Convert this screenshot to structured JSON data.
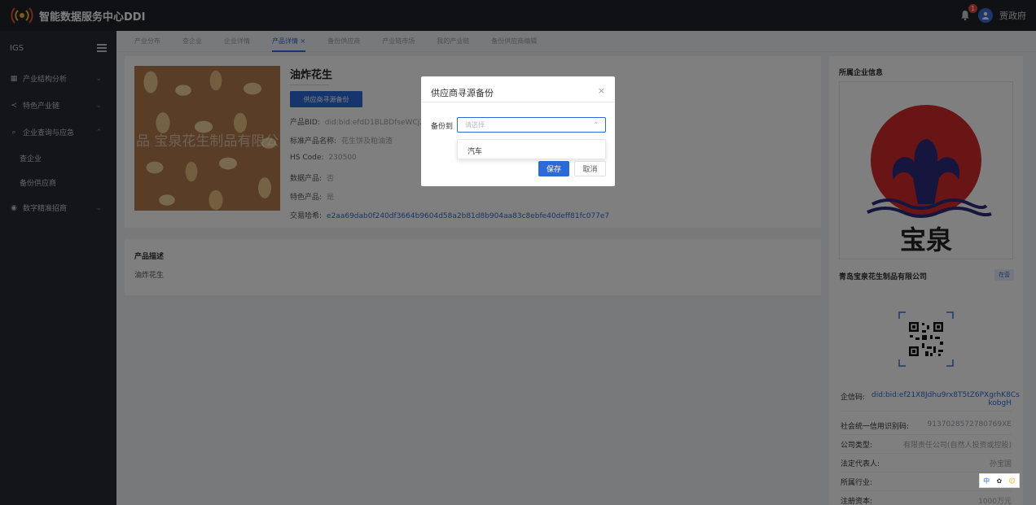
{
  "app": {
    "title": "智能数据服务中心DDI"
  },
  "header": {
    "notification_count": "1",
    "user_name": "贾政府"
  },
  "sidebar": {
    "section_label": "IGS",
    "items": [
      {
        "label": "产业结构分析",
        "icon": "grid-icon"
      },
      {
        "label": "特色产业链",
        "icon": "share-icon"
      },
      {
        "label": "企业查询与应急",
        "icon": "search-icon"
      },
      {
        "label": "数字精准招商",
        "icon": "target-icon"
      }
    ],
    "sub_items": [
      {
        "label": "查企业"
      },
      {
        "label": "备份供应商"
      }
    ]
  },
  "tabs": [
    {
      "label": "产业分布"
    },
    {
      "label": "查企业"
    },
    {
      "label": "企业详情"
    },
    {
      "label": "产品详情",
      "active": true
    },
    {
      "label": "备份供应商"
    },
    {
      "label": "产业链市场"
    },
    {
      "label": "我的产业链"
    },
    {
      "label": "备份供应商编辑"
    }
  ],
  "product": {
    "name": "油炸花生",
    "supplier_button": "供应商寻源备份",
    "image_watermark": "品 宝泉花生制品有限公",
    "fields": [
      {
        "key": "产品BID:",
        "value": "did:bid:efdD1BLBDfseWCj2"
      },
      {
        "key": "标准产品名称:",
        "value": "花生饼及粕油渣"
      },
      {
        "key": "HS Code:",
        "value": "230500"
      },
      {
        "key": "数据产品:",
        "value": "否"
      },
      {
        "key": "特色产品:",
        "value": "是"
      },
      {
        "key": "交易哈希:",
        "value": "e2aa69dab0f240df3664b9604d58a2b81d8b904aa83c8ebfe40deff81fc077e7"
      }
    ]
  },
  "description": {
    "title": "产品描述",
    "text": "油炸花生"
  },
  "company": {
    "panel_title": "所属企业信息",
    "logo_text": "宝泉",
    "name": "青岛宝泉花生制品有限公司",
    "status": "在营",
    "fields": [
      {
        "key": "企信码:",
        "value": "did:bid:ef21X8Jdhu9rx8T5tZ6PXgrhK8Cs kobgH"
      },
      {
        "key": "社会统一信用识别码:",
        "value": "91370285727807​69XE"
      },
      {
        "key": "公司类型:",
        "value": "有限责任公司(自然人投资或控股)"
      },
      {
        "key": "法定代表人:",
        "value": "孙宝国"
      },
      {
        "key": "所属行业:",
        "value": ""
      },
      {
        "key": "注册资本:",
        "value": "1000万元"
      }
    ],
    "float_tools": [
      "中",
      "✿",
      "☺"
    ]
  },
  "modal": {
    "title": "供应商寻源备份",
    "field_label": "备份到",
    "select_placeholder": "请选择",
    "options": [
      "汽车"
    ],
    "save_label": "保存",
    "cancel_label": "取消"
  },
  "colors": {
    "accent": "#2d6ad8",
    "topbar": "#1f2329",
    "sidebar": "#262a31"
  }
}
